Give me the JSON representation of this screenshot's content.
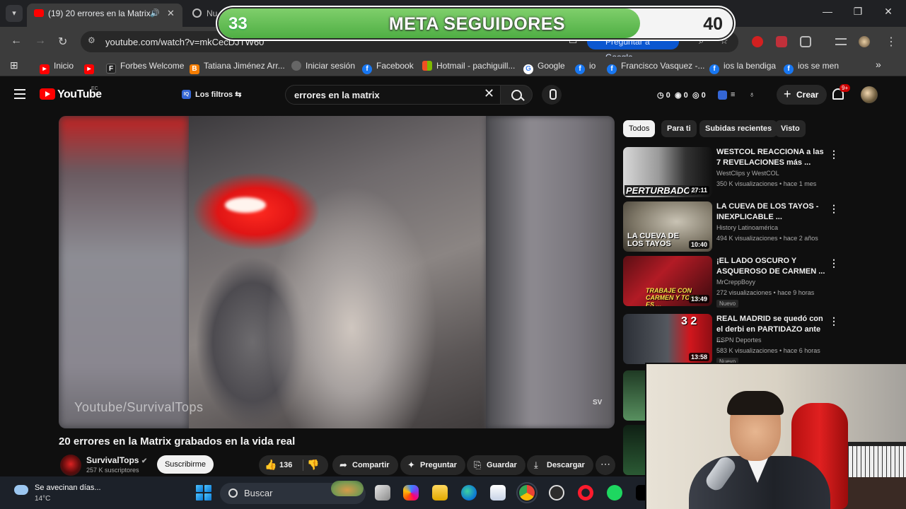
{
  "overlay_goal": {
    "start": "33",
    "title": "META SEGUIDORES",
    "end": "40",
    "progress_fraction": 0.82,
    "fill_color": "#5cb94c"
  },
  "browser": {
    "tabs": [
      {
        "title": "(19) 20 errores en la Matrix",
        "active": true,
        "icon": "youtube-icon"
      },
      {
        "title": "Nu",
        "active": false,
        "icon": "globe-icon"
      }
    ],
    "window_controls": [
      "—",
      "❐",
      "✕"
    ],
    "url": "youtube.com/watch?v=mkCecDJTW60",
    "ask_google": "Preguntar a Google",
    "bookmarks": [
      {
        "label": "Inicio",
        "icon": "youtube-icon",
        "color": "#ff0000"
      },
      {
        "label": "",
        "icon": "youtube-icon",
        "color": "#ff0000"
      },
      {
        "label": "Forbes Welcome",
        "icon": "forbes-icon",
        "color": "#222222"
      },
      {
        "label": "Tatiana Jiménez Arr...",
        "icon": "blogger-icon",
        "color": "#f57d00"
      },
      {
        "label": "Iniciar sesión",
        "icon": "globe-icon",
        "color": "#888888"
      },
      {
        "label": "Facebook",
        "icon": "facebook-icon",
        "color": "#1877f2"
      },
      {
        "label": "Hotmail - pachiguill...",
        "icon": "windows-icon",
        "color": "#f25022"
      },
      {
        "label": "Google",
        "icon": "google-icon",
        "color": "#ffffff"
      },
      {
        "label": "io",
        "icon": "facebook-icon",
        "color": "#1877f2"
      },
      {
        "label": "Francisco Vasquez -...",
        "icon": "facebook-icon",
        "color": "#1877f2"
      },
      {
        "label": "ios la bendiga",
        "icon": "facebook-icon",
        "color": "#1877f2"
      },
      {
        "label": "ios se men",
        "icon": "facebook-icon",
        "color": "#1877f2"
      }
    ]
  },
  "youtube": {
    "logo": "YouTube",
    "country": "EC",
    "filters": "Los filtros",
    "search_query": "errores en la matrix",
    "header_stats": [
      "0",
      "0",
      "0"
    ],
    "create": "Crear",
    "notifications": "9+",
    "video": {
      "watermark": "Youtube/SurvivalTops",
      "corner_mark": "SV",
      "title": "20 errores en la Matrix grabados en la vida real",
      "channel": "SurvivalTops",
      "subscribers": "257 K suscriptores",
      "subscribe": "Suscribirme",
      "likes": "136",
      "actions": [
        "Compartir",
        "Preguntar",
        "Guardar",
        "Descargar"
      ]
    },
    "chips": [
      "Todos",
      "Para ti",
      "Subidas recientes",
      "Visto"
    ],
    "recommendations": [
      {
        "title": "WESTCOL REACCIONA a las 7 REVELACIONES más ...",
        "channel": "WestClips y WestCOL",
        "meta": "350 K visualizaciones • hace 1 mes",
        "duration": "27:11",
        "thumb_text": "PERTURBADOR",
        "badge": ""
      },
      {
        "title": "LA CUEVA DE LOS TAYOS - INEXPLICABLE ...",
        "channel": "History Latinoamérica",
        "meta": "494 K visualizaciones • hace 2 años",
        "duration": "10:40",
        "thumb_text": "LA CUEVA DE LOS TAYOS",
        "badge": ""
      },
      {
        "title": "¡EL LADO OSCURO Y ASQUEROSO DE CARMEN ...",
        "channel": "MrCreppBoyy",
        "meta": "272 visualizaciones • hace 9 horas",
        "duration": "13:49",
        "thumb_text": "TRABAJE CON CARMEN Y TODO ES ...",
        "badge": "Nuevo"
      },
      {
        "title": "REAL MADRID se quedó con el derbi en PARTIDAZO ante ...",
        "channel": "ESPN Deportes",
        "meta": "583 K visualizaciones • hace 6 horas",
        "duration": "13:58",
        "thumb_text": "3 2",
        "badge": "Nuevo"
      }
    ]
  },
  "taskbar": {
    "weather": "Se avecinan días...",
    "temperature": "14°C",
    "search": "Buscar"
  }
}
